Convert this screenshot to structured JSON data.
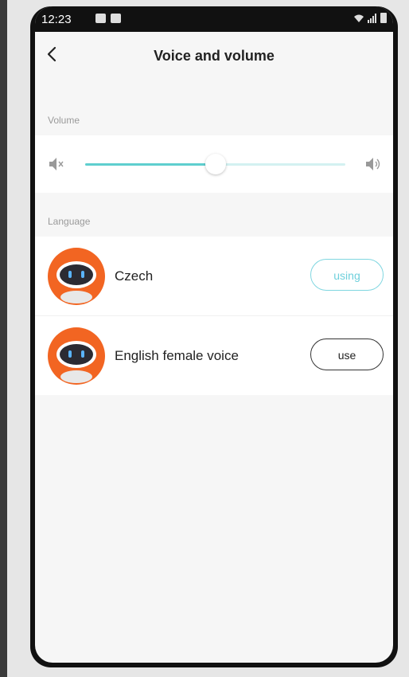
{
  "status_bar": {
    "time": "12:23",
    "left_icons": [
      "image-notification-icon",
      "battery-notification-icon"
    ],
    "right_icons": [
      "wifi-icon",
      "signal-icon",
      "battery-icon"
    ]
  },
  "header": {
    "title": "Voice and volume",
    "back_icon": "chevron-left-icon"
  },
  "volume": {
    "section_label": "Volume",
    "level": 0.5,
    "min_icon": "mute-speaker-icon",
    "max_icon": "loud-speaker-icon",
    "accent_color": "#5fcfcf"
  },
  "language": {
    "section_label": "Language",
    "items": [
      {
        "name": "Czech",
        "button_label": "using",
        "selected": true
      },
      {
        "name": "English female voice",
        "button_label": "use",
        "selected": false
      }
    ]
  },
  "colors": {
    "avatar_orange": "#f26522",
    "active_outline": "#7fd6e0"
  }
}
